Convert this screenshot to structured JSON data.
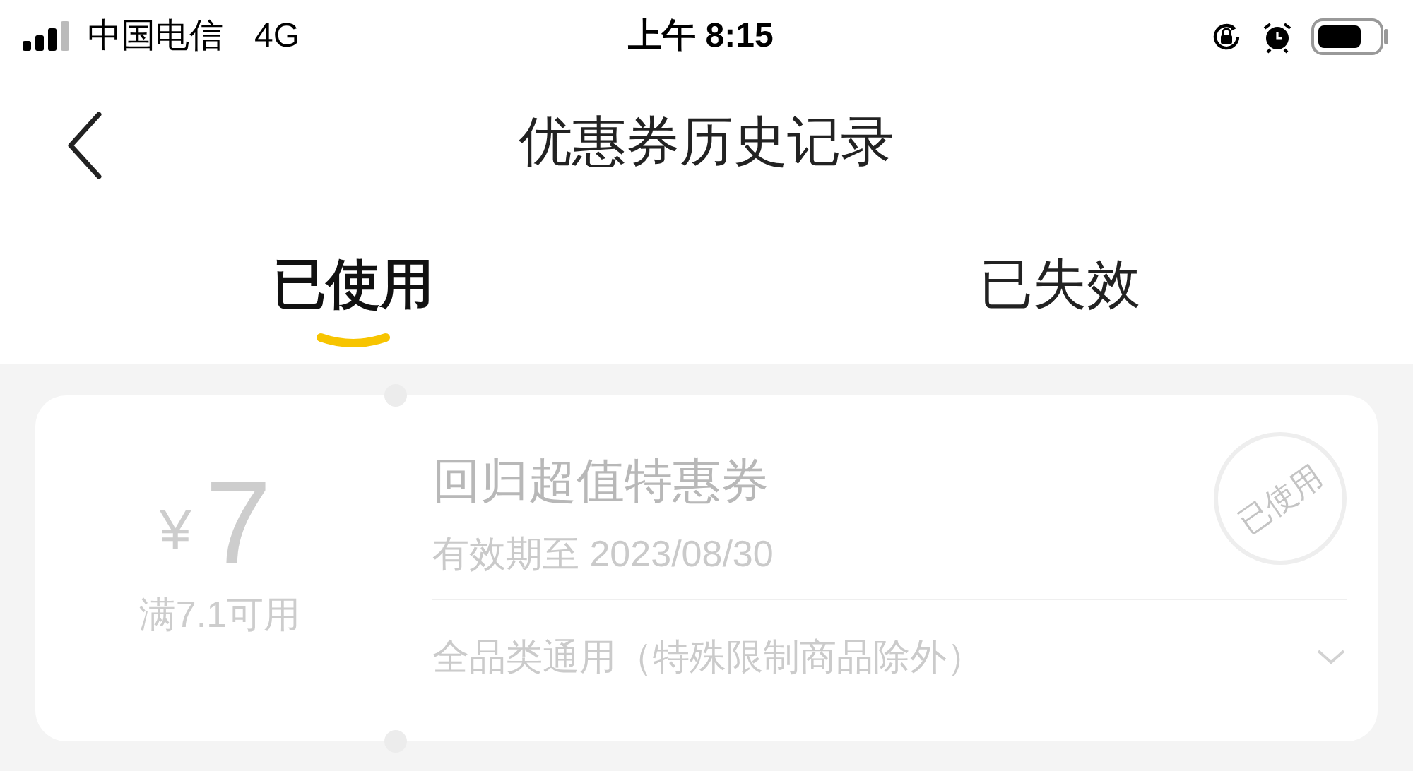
{
  "status_bar": {
    "carrier": "中国电信",
    "network": "4G",
    "time": "上午 8:15"
  },
  "nav": {
    "title": "优惠券历史记录"
  },
  "tabs": [
    {
      "label": "已使用",
      "selected": true
    },
    {
      "label": "已失效",
      "selected": false
    }
  ],
  "coupons": [
    {
      "currency": "¥",
      "amount": "7",
      "condition": "满7.1可用",
      "name": "回归超值特惠券",
      "validity": "有效期至 2023/08/30",
      "stamp": "已使用",
      "scope": "全品类通用（特殊限制商品除外）",
      "expanded": false
    }
  ]
}
